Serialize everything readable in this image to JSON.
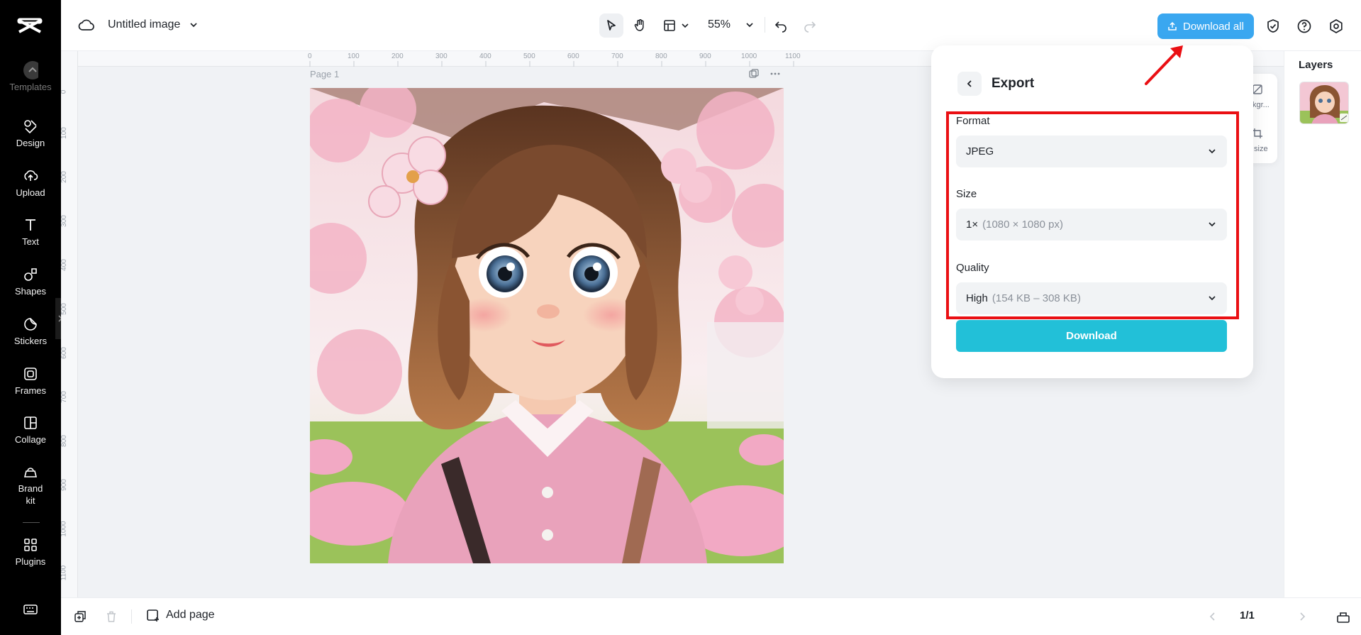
{
  "sidebar": {
    "items": [
      {
        "label": "Templates",
        "icon": "templates-icon"
      },
      {
        "label": "Design",
        "icon": "design-icon"
      },
      {
        "label": "Upload",
        "icon": "upload-icon"
      },
      {
        "label": "Text",
        "icon": "text-icon"
      },
      {
        "label": "Shapes",
        "icon": "shapes-icon"
      },
      {
        "label": "Stickers",
        "icon": "stickers-icon"
      },
      {
        "label": "Frames",
        "icon": "frames-icon"
      },
      {
        "label": "Collage",
        "icon": "collage-icon"
      },
      {
        "label": "Brand kit",
        "icon": "brand-kit-icon"
      },
      {
        "label": "Plugins",
        "icon": "plugins-icon"
      }
    ]
  },
  "topbar": {
    "doc_title": "Untitled image",
    "zoom": "55%",
    "download_all": "Download all"
  },
  "canvas": {
    "page_label": "Page 1",
    "ruler_top": [
      "0",
      "100",
      "200",
      "300",
      "400",
      "500",
      "600",
      "700",
      "800",
      "900",
      "1000",
      "1100"
    ],
    "ruler_left": [
      "0",
      "100",
      "200",
      "300",
      "400",
      "500",
      "600",
      "700",
      "800",
      "900",
      "1000",
      "1100"
    ]
  },
  "layers": {
    "title": "Layers"
  },
  "mini_panel": {
    "line1": "kgr...",
    "line2": "size"
  },
  "export": {
    "title": "Export",
    "format_label": "Format",
    "format_value": "JPEG",
    "size_label": "Size",
    "size_value": "1×",
    "size_detail": "(1080 × 1080 px)",
    "quality_label": "Quality",
    "quality_value": "High",
    "quality_detail": "(154 KB – 308 KB)",
    "download": "Download"
  },
  "bottombar": {
    "add_page": "Add page",
    "page_counter": "1/1"
  },
  "colors": {
    "accent": "#3aa7f0",
    "download_button": "#22c0d8",
    "highlight": "#ea0f13"
  }
}
